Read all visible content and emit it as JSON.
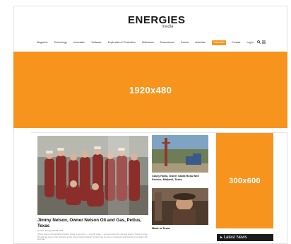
{
  "header": {
    "logo_text": "ENERGIES",
    "logo_subtext": "media"
  },
  "nav": {
    "items": [
      "Magazine",
      "Technology",
      "Innovation",
      "Software",
      "Exploration & Production",
      "Midstream",
      "Downstream",
      "Events",
      "Advertise"
    ],
    "subscribe_label": "Subscribe",
    "contact_label": "Contact",
    "login_label": "Log In",
    "search_icon": "search-icon",
    "menu_icon": "menu-icon"
  },
  "ads": {
    "leaderboard_label": "1920x480",
    "side_label": "300x600",
    "accent_color": "#f7941d"
  },
  "feature": {
    "title": "Jimmy Nelson, Owner Nelson Oil and Gas, Pettus, Texas",
    "byline": "by U.S. Energy Media Staff",
    "excerpt": "\"We've been in the oil field in Pettus, Texas, a long time — over 30 years — so we've seen the ups and downs. That's for sure. My dad has been in the business as the oil and started Nelson Oil and Gas. He was a roughneck and worked up to Nelson Oil and Gas.\""
  },
  "side_stories": [
    {
      "caption": "Casey Hutto, Owner Santa Rosa Well Service, Midland, Texas"
    },
    {
      "caption": "Made in Texas"
    }
  ],
  "sidebar": {
    "latest_label": "Latest News"
  }
}
